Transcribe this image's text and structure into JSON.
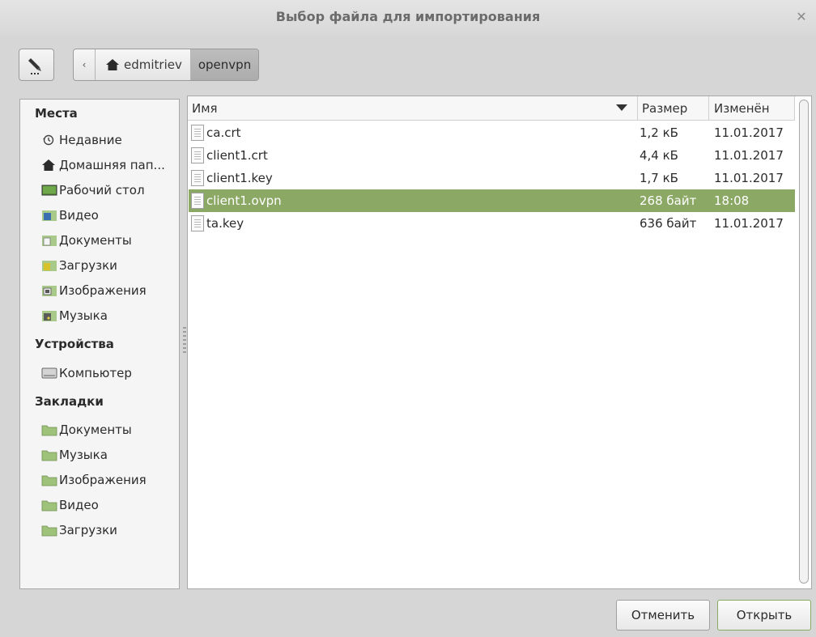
{
  "window": {
    "title": "Выбор файла для импортирования"
  },
  "pathbar": {
    "segments": [
      "edmitriev",
      "openvpn"
    ]
  },
  "sidebar": {
    "places_header": "Места",
    "places": [
      {
        "label": "Недавние",
        "icon": "recent-icon"
      },
      {
        "label": "Домашняя пап...",
        "icon": "home-icon"
      },
      {
        "label": "Рабочий стол",
        "icon": "desktop-icon"
      },
      {
        "label": "Видео",
        "icon": "videos-folder-icon"
      },
      {
        "label": "Документы",
        "icon": "documents-folder-icon"
      },
      {
        "label": "Загрузки",
        "icon": "downloads-folder-icon"
      },
      {
        "label": "Изображения",
        "icon": "pictures-folder-icon"
      },
      {
        "label": "Музыка",
        "icon": "music-folder-icon"
      }
    ],
    "devices_header": "Устройства",
    "devices": [
      {
        "label": "Компьютер",
        "icon": "drive-icon"
      }
    ],
    "bookmarks_header": "Закладки",
    "bookmarks": [
      {
        "label": "Документы",
        "icon": "folder-icon"
      },
      {
        "label": "Музыка",
        "icon": "folder-icon"
      },
      {
        "label": "Изображения",
        "icon": "folder-icon"
      },
      {
        "label": "Видео",
        "icon": "folder-icon"
      },
      {
        "label": "Загрузки",
        "icon": "folder-icon"
      }
    ]
  },
  "filelist": {
    "columns": {
      "name": "Имя",
      "size": "Размер",
      "modified": "Изменён"
    },
    "files": [
      {
        "name": "ca.crt",
        "size": "1,2 кБ",
        "modified": "11.01.2017"
      },
      {
        "name": "client1.crt",
        "size": "4,4 кБ",
        "modified": "11.01.2017"
      },
      {
        "name": "client1.key",
        "size": "1,7 кБ",
        "modified": "11.01.2017"
      },
      {
        "name": "client1.ovpn",
        "size": "268 байт",
        "modified": "18:08",
        "selected": true
      },
      {
        "name": "ta.key",
        "size": "636 байт",
        "modified": "11.01.2017"
      }
    ]
  },
  "buttons": {
    "cancel": "Отменить",
    "open": "Открыть"
  },
  "colors": {
    "selection": "#8ba865",
    "sidebar_bg": "#f5f5f5",
    "dialog_bg": "#d6d6d6"
  }
}
